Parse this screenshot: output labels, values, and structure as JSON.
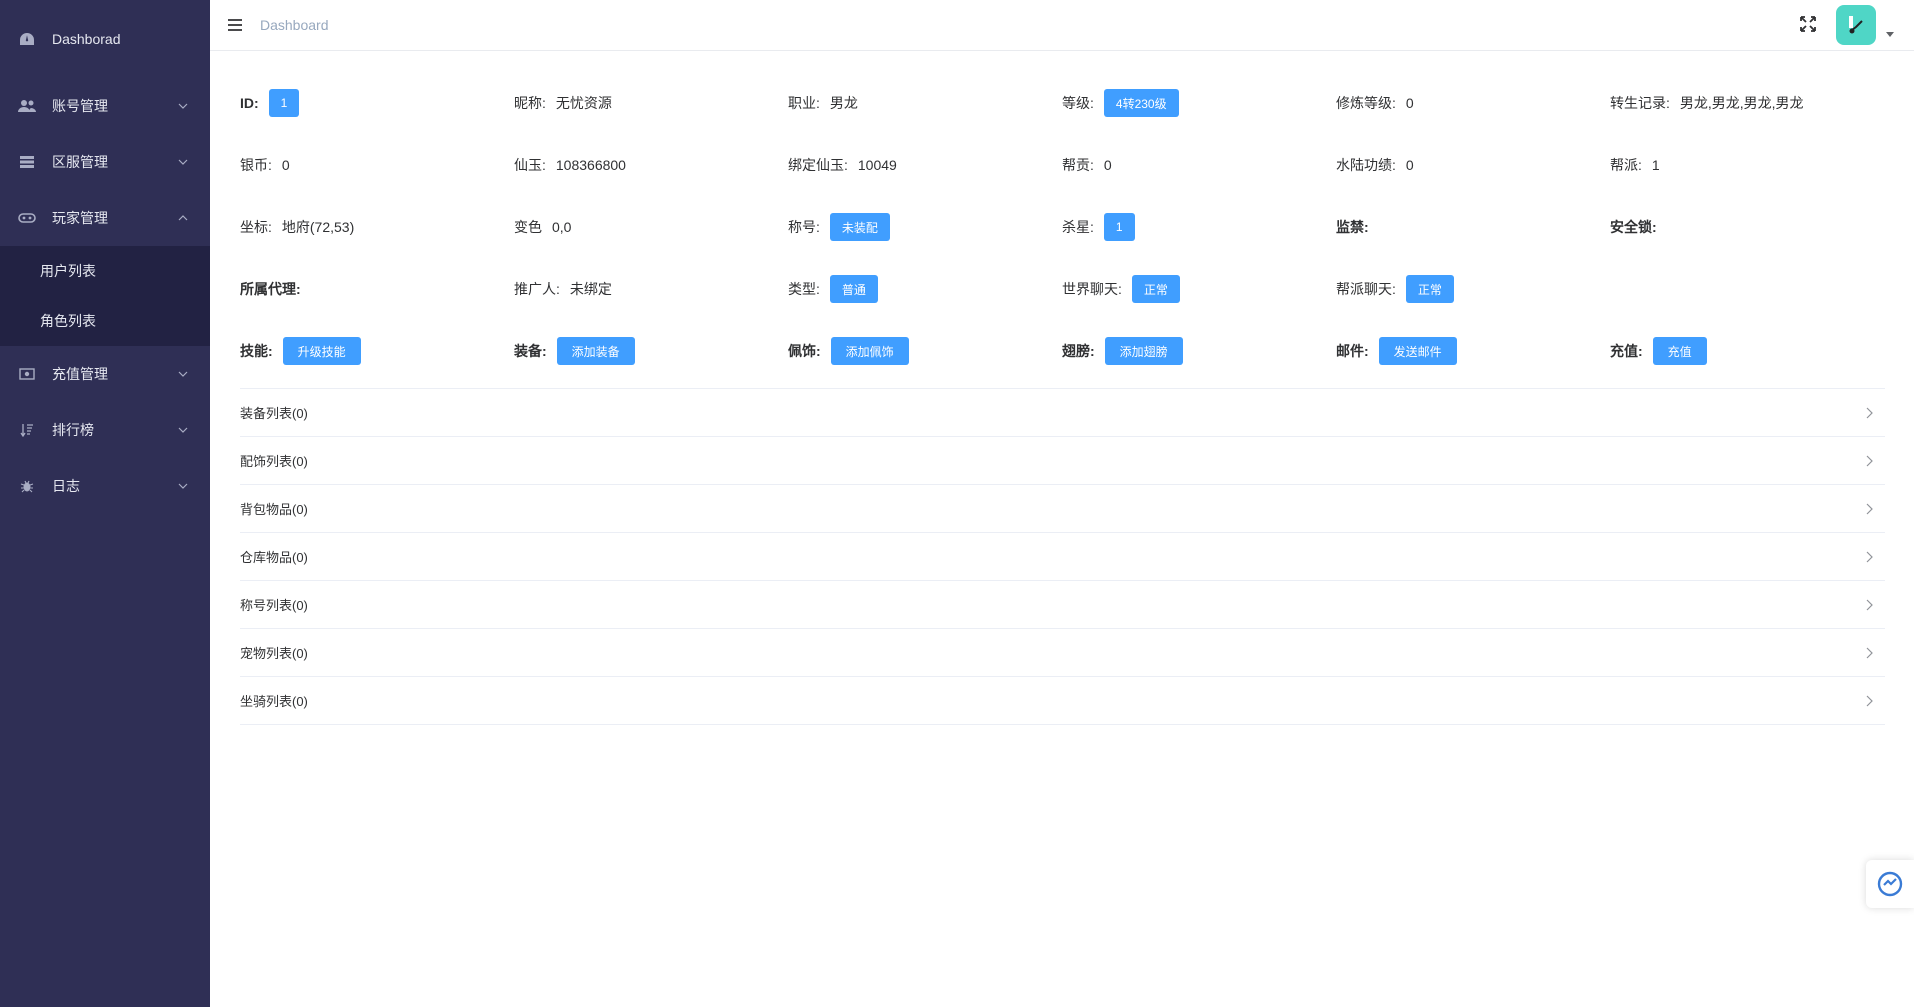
{
  "sidebar": {
    "items": [
      {
        "label": "Dashborad",
        "icon": "dashboard-icon"
      },
      {
        "label": "账号管理",
        "icon": "users-icon"
      },
      {
        "label": "区服管理",
        "icon": "server-icon"
      },
      {
        "label": "玩家管理",
        "icon": "gamepad-icon"
      },
      {
        "label": "充值管理",
        "icon": "money-icon"
      },
      {
        "label": "排行榜",
        "icon": "sort-icon"
      },
      {
        "label": "日志",
        "icon": "bug-icon"
      }
    ],
    "submenu": [
      "用户列表",
      "角色列表"
    ]
  },
  "header": {
    "breadcrumb": "Dashboard"
  },
  "info": {
    "row1": {
      "id_label": "ID:",
      "id_value": "1",
      "nickname_label": "昵称:",
      "nickname_value": "无忧资源",
      "job_label": "职业:",
      "job_value": "男龙",
      "level_label": "等级:",
      "level_value": "4转230级",
      "cultivation_label": "修炼等级:",
      "cultivation_value": "0",
      "rebirth_label": "转生记录:",
      "rebirth_value": "男龙,男龙,男龙,男龙"
    },
    "row2": {
      "silver_label": "银币:",
      "silver_value": "0",
      "xianyu_label": "仙玉:",
      "xianyu_value": "108366800",
      "bound_label": "绑定仙玉:",
      "bound_value": "10049",
      "contrib_label": "帮贡:",
      "contrib_value": "0",
      "merit_label": "水陆功绩:",
      "merit_value": "0",
      "guild_label": "帮派:",
      "guild_value": "1"
    },
    "row3": {
      "coord_label": "坐标:",
      "coord_value": "地府(72,53)",
      "color_label": "变色",
      "color_value": "0,0",
      "title_label": "称号:",
      "title_value": "未装配",
      "kill_label": "杀星:",
      "kill_value": "1",
      "ban_label": "监禁:",
      "lock_label": "安全锁:"
    },
    "row4": {
      "agent_label": "所属代理:",
      "promoter_label": "推广人:",
      "promoter_value": "未绑定",
      "type_label": "类型:",
      "type_value": "普通",
      "world_label": "世界聊天:",
      "world_value": "正常",
      "guildchat_label": "帮派聊天:",
      "guildchat_value": "正常"
    },
    "row5": {
      "skill_label": "技能:",
      "skill_btn": "升级技能",
      "equip_label": "装备:",
      "equip_btn": "添加装备",
      "accessory_label": "佩饰:",
      "accessory_btn": "添加佩饰",
      "wing_label": "翅膀:",
      "wing_btn": "添加翅膀",
      "mail_label": "邮件:",
      "mail_btn": "发送邮件",
      "recharge_label": "充值:",
      "recharge_btn": "充值"
    }
  },
  "collapse": [
    "装备列表(0)",
    "配饰列表(0)",
    "背包物品(0)",
    "仓库物品(0)",
    "称号列表(0)",
    "宠物列表(0)",
    "坐骑列表(0)"
  ],
  "colors": {
    "sidebar_bg": "#2f2f55",
    "submenu_bg": "#222243",
    "primary": "#409eff",
    "avatar_bg": "#4fd6c6"
  }
}
